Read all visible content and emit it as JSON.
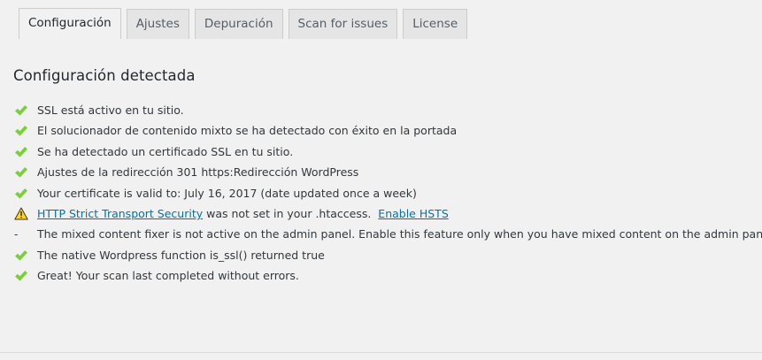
{
  "tabs": [
    {
      "label": "Configuración",
      "active": true
    },
    {
      "label": "Ajustes",
      "active": false
    },
    {
      "label": "Depuración",
      "active": false
    },
    {
      "label": "Scan for issues",
      "active": false
    },
    {
      "label": "License",
      "active": false
    }
  ],
  "section": {
    "title": "Configuración detectada"
  },
  "checks": {
    "ssl_active": {
      "status": "success",
      "icon": "check-icon",
      "text": "SSL está activo en tu sitio."
    },
    "mixed_content": {
      "status": "success",
      "icon": "check-icon",
      "text": "El solucionador de contenido mixto se ha detectado con éxito en la portada"
    },
    "certificate": {
      "status": "success",
      "icon": "check-icon",
      "text": "Se ha detectado un certificado SSL en tu sitio."
    },
    "redirect": {
      "status": "success",
      "icon": "check-icon",
      "text": "Ajustes de la redirección 301 https:Redirección WordPress"
    },
    "valid_to": {
      "status": "success",
      "icon": "check-icon",
      "text": "Your certificate is valid to: July 16, 2017 (date updated once a week)"
    },
    "hsts": {
      "status": "warning",
      "icon": "warning-icon",
      "link_text": "HTTP Strict Transport Security",
      "text": " was not set in your .htaccess.",
      "action_link": "Enable HSTS"
    },
    "admin_mixed": {
      "status": "neutral",
      "icon": "-",
      "text": "The mixed content fixer is not active on the admin panel. Enable this feature only when you have mixed content on the admin panel."
    },
    "is_ssl": {
      "status": "success",
      "icon": "check-icon",
      "text": "The native Wordpress function is_ssl() returned true"
    },
    "scan": {
      "status": "success",
      "icon": "check-icon",
      "text": "Great! Your scan last completed without errors."
    }
  },
  "colors": {
    "success": "#7ad03a",
    "warning": "#ffd32a",
    "link": "#0073aa",
    "background": "#f1f1f1"
  }
}
